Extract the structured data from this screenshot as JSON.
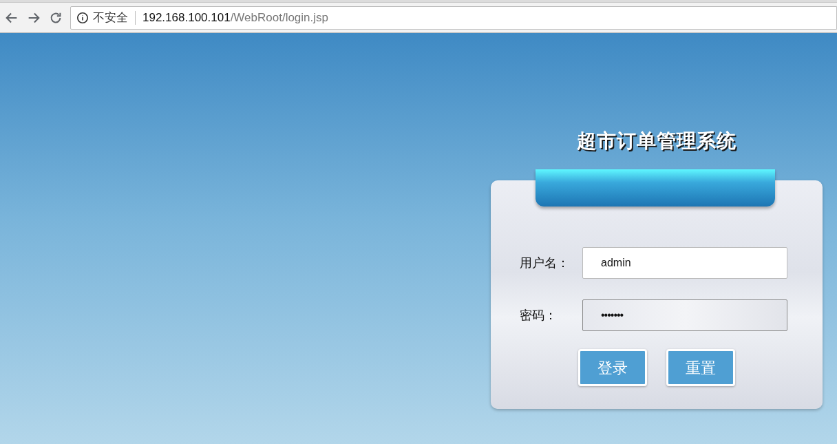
{
  "browser": {
    "security_label": "不安全",
    "url_host": "192.168.100.101",
    "url_path": "/WebRoot/login.jsp"
  },
  "login": {
    "title": "超市订单管理系统",
    "fields": [
      {
        "label": "用户名：",
        "value": "admin",
        "kind": "text"
      },
      {
        "label": "密码：",
        "value": "•••••••",
        "kind": "password"
      }
    ],
    "buttons": [
      "登录",
      "重置"
    ]
  }
}
